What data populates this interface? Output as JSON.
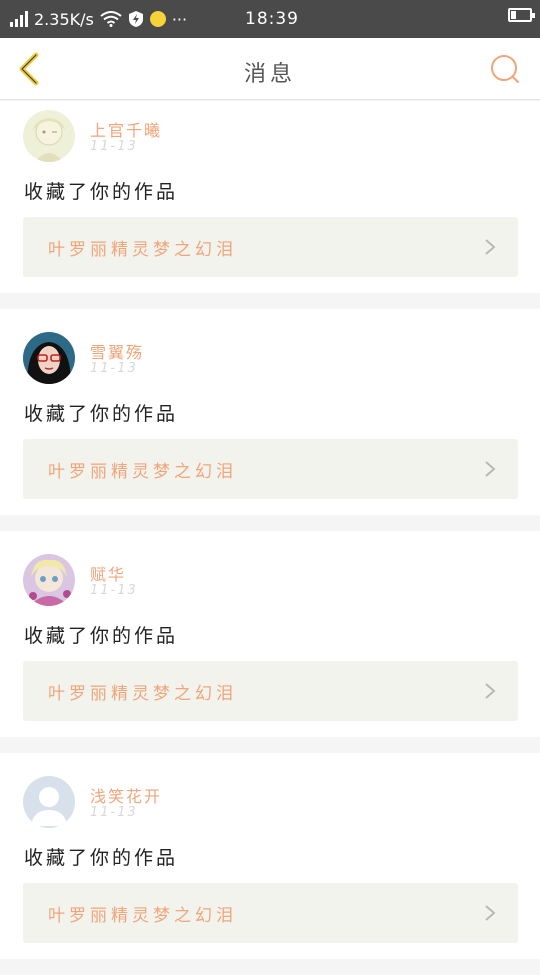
{
  "status_bar": {
    "speed": "2.35K/s",
    "time": "18:39",
    "more": "···"
  },
  "nav": {
    "title": "消息"
  },
  "colors": {
    "accent": "#f0a57a",
    "back_icon": "#f2cc3c",
    "link_bg": "#f3f3ee",
    "status_bg": "#4a4a4a"
  },
  "messages": [
    {
      "user": "上官千曦",
      "date": "11-13",
      "action": "收藏了你的作品",
      "work": "叶罗丽精灵梦之幻泪"
    },
    {
      "user": "雪翼殇",
      "date": "11-13",
      "action": "收藏了你的作品",
      "work": "叶罗丽精灵梦之幻泪"
    },
    {
      "user": "赋华",
      "date": "11-13",
      "action": "收藏了你的作品",
      "work": "叶罗丽精灵梦之幻泪"
    },
    {
      "user": "浅笑花开",
      "date": "11-13",
      "action": "收藏了你的作品",
      "work": "叶罗丽精灵梦之幻泪"
    }
  ]
}
